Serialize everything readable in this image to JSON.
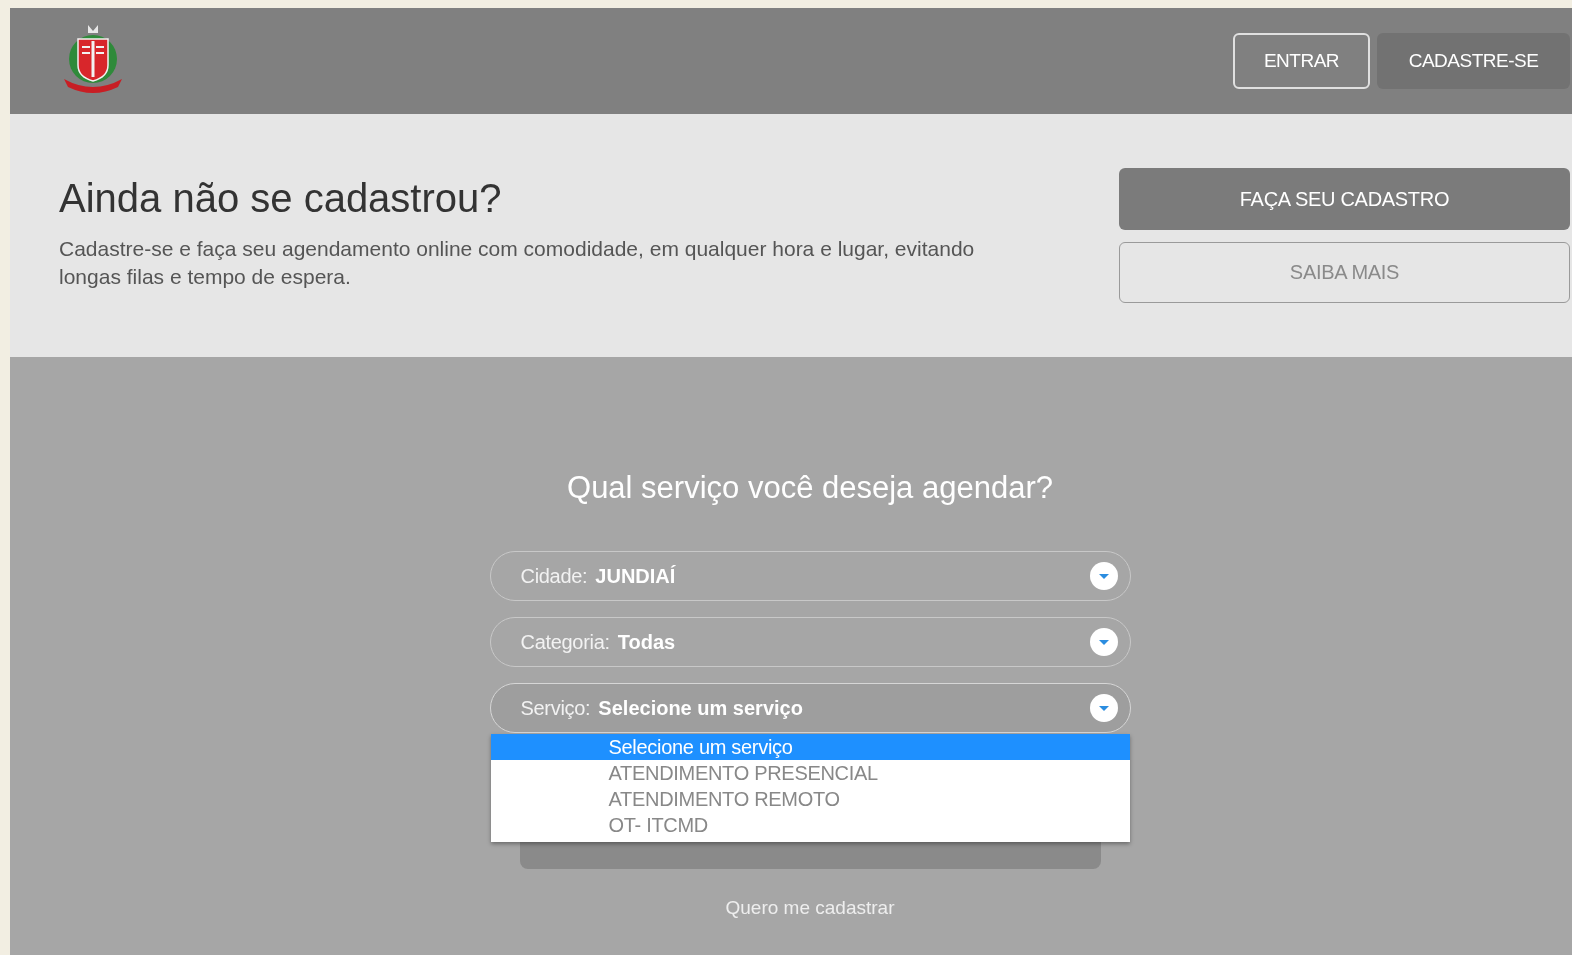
{
  "header": {
    "buttons": [
      {
        "label": "ENTRAR",
        "kind": "outline"
      },
      {
        "label": "CADASTRE-SE",
        "kind": "filled"
      }
    ]
  },
  "banner": {
    "title": "Ainda não se cadastrou?",
    "text": "Cadastre-se e faça seu agendamento online com comodidade, em qualquer hora e lugar, evitando longas filas e tempo de espera.",
    "buttons": [
      {
        "label": "FAÇA SEU CADASTRO",
        "kind": "filled"
      },
      {
        "label": "SAIBA MAIS",
        "kind": "outline"
      }
    ]
  },
  "form": {
    "title": "Qual serviço você deseja agendar?",
    "selects": [
      {
        "label": "Cidade:",
        "value": "JUNDIAÍ",
        "expanded": false
      },
      {
        "label": "Categoria:",
        "value": "Todas",
        "expanded": false
      },
      {
        "label": "Serviço:",
        "value": "Selecione um serviço",
        "expanded": true
      }
    ],
    "options": [
      {
        "label": "Selecione um serviço",
        "selected": true
      },
      {
        "label": "ATENDIMENTO PRESENCIAL",
        "selected": false
      },
      {
        "label": "ATENDIMENTO REMOTO",
        "selected": false
      },
      {
        "label": "OT- ITCMD",
        "selected": false
      }
    ],
    "link": "Quero me cadastrar"
  }
}
